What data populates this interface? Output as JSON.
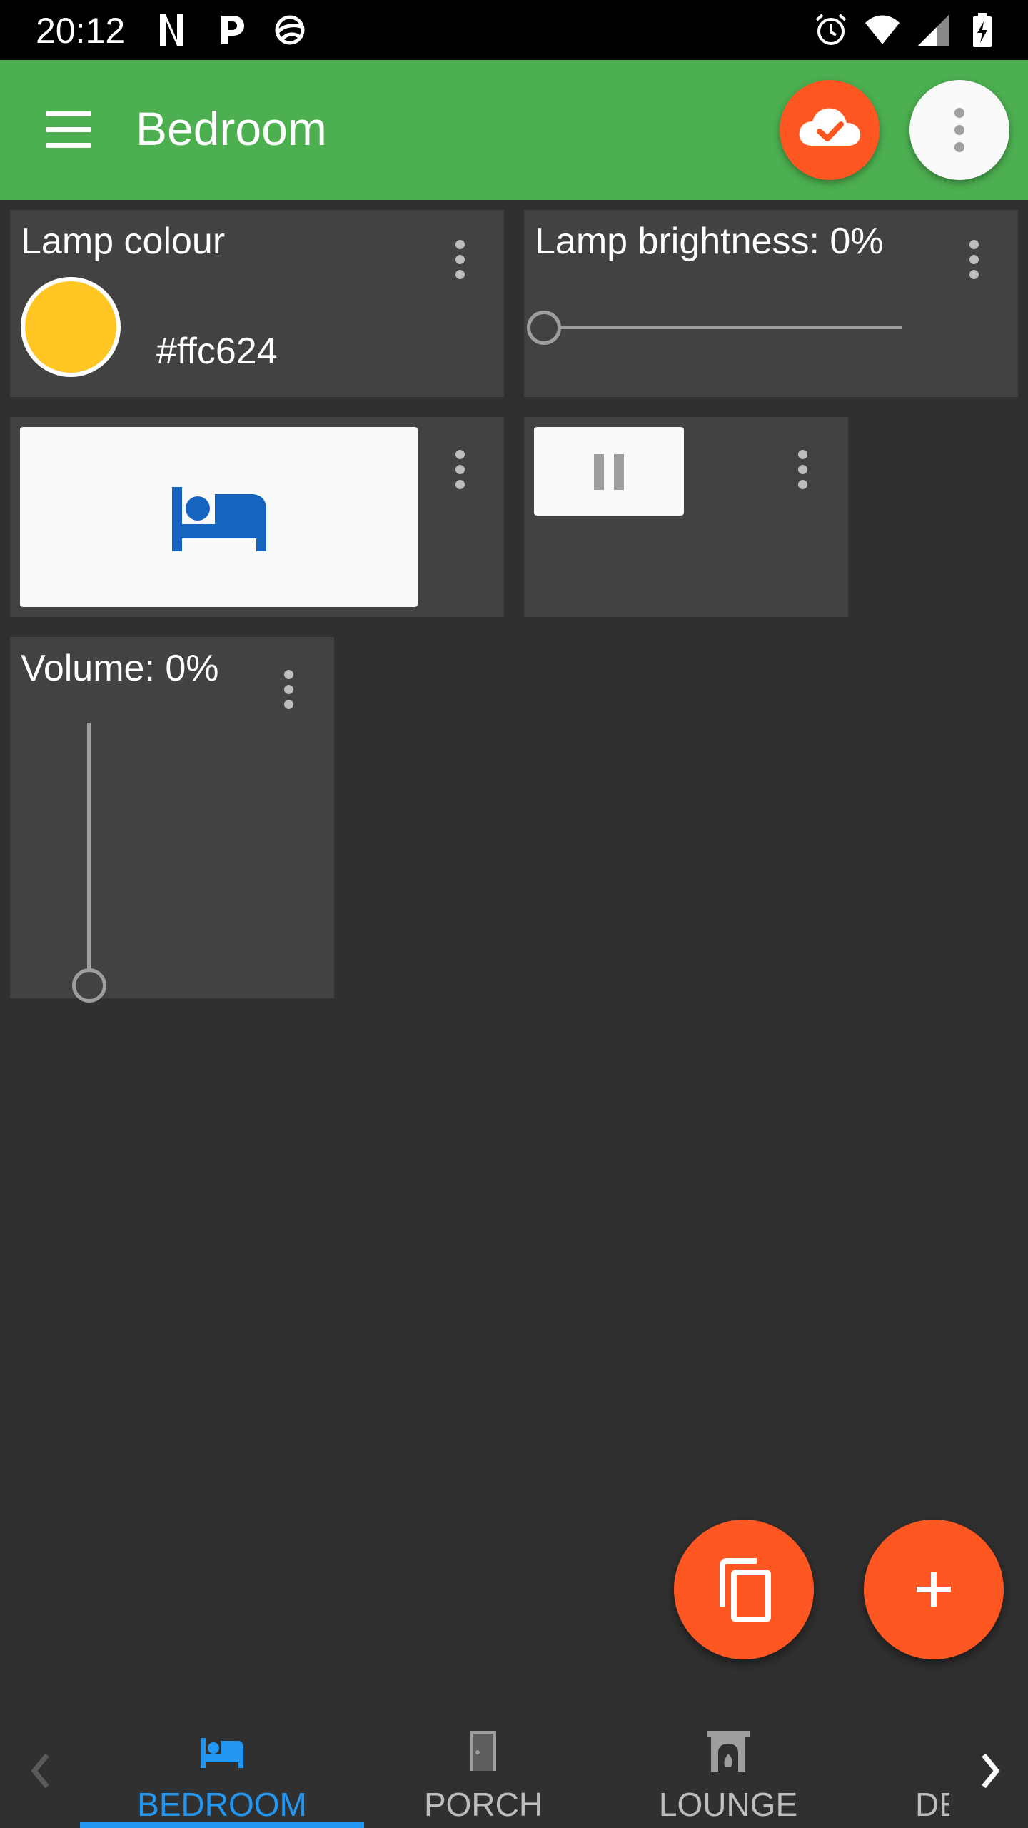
{
  "status_bar": {
    "time": "20:12",
    "left_icons": [
      "netflix-icon",
      "pandora-icon",
      "sync-icon"
    ],
    "right_icons": [
      "alarm-icon",
      "wifi-icon",
      "signal-icon",
      "battery-charging-icon"
    ]
  },
  "app_bar": {
    "title": "Bedroom",
    "menu_icon": "menu-icon",
    "cloud_status_icon": "cloud-done-icon",
    "overflow_icon": "more-vert-icon",
    "color": "#4caf50"
  },
  "widgets": {
    "lamp_colour": {
      "title": "Lamp colour",
      "hex_value": "#ffc624",
      "swatch_color": "#ffc624"
    },
    "lamp_brightness": {
      "title": "Lamp brightness: 0%",
      "value": 0
    },
    "scene": {
      "icon": "bed-icon",
      "icon_color": "#1565c0"
    },
    "pause": {
      "icon": "pause-icon"
    },
    "volume": {
      "title": "Volume: 0%",
      "value": 0
    }
  },
  "fabs": {
    "copy_icon": "copy-icon",
    "add_icon": "add-icon",
    "color": "#ff5722"
  },
  "tabs": [
    {
      "label": "BEDROOM",
      "icon": "bed-icon",
      "selected": true
    },
    {
      "label": "PORCH",
      "icon": "door-icon",
      "selected": false
    },
    {
      "label": "LOUNGE",
      "icon": "fireplace-icon",
      "selected": false
    },
    {
      "label": "DE",
      "icon": "",
      "selected": false
    }
  ]
}
